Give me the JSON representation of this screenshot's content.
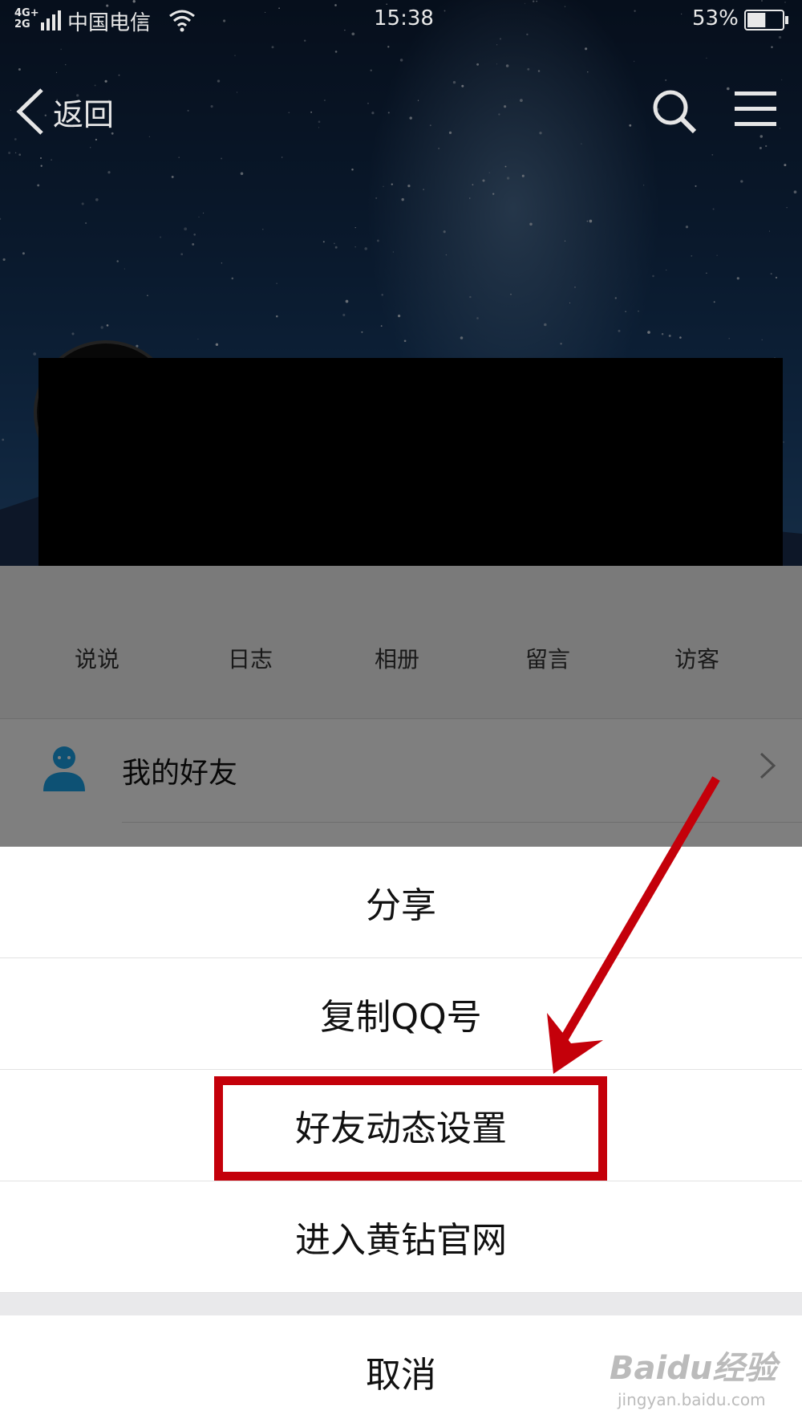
{
  "status_bar": {
    "network": "4G+\n2G",
    "carrier": "中国电信",
    "time": "15:38",
    "battery_percent": "53%",
    "battery_level": 0.53
  },
  "nav": {
    "back_label": "返回",
    "icons": [
      "chevron-left-icon",
      "search-icon",
      "menu-icon"
    ]
  },
  "profile_tabs": [
    "说说",
    "日志",
    "相册",
    "留言",
    "访客"
  ],
  "friend_row": {
    "label": "我的好友",
    "icon": "person-icon"
  },
  "action_sheet": {
    "items": [
      "分享",
      "复制QQ号",
      "好友动态设置",
      "进入黄钻官网"
    ],
    "cancel": "取消",
    "highlighted_item": "好友动态设置"
  },
  "watermark": {
    "main": "Baidu经验",
    "sub": "jingyan.baidu.com"
  },
  "colors": {
    "highlight": "#c4000a",
    "friend_icon": "#1aa3e8"
  }
}
